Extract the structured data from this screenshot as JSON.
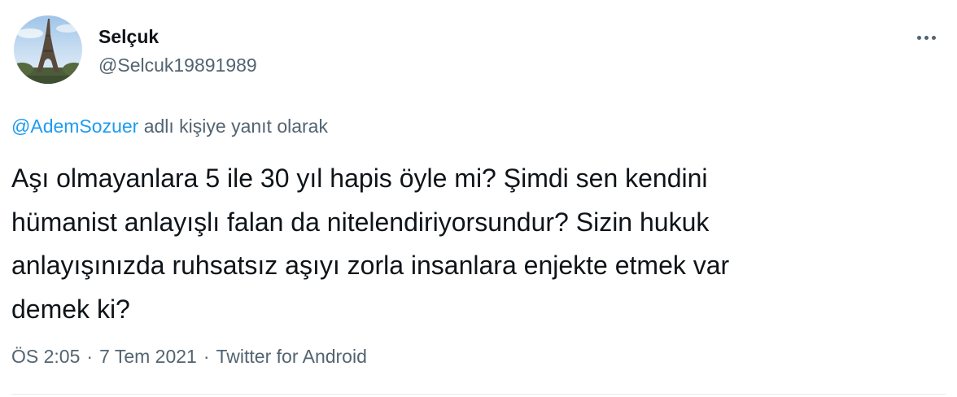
{
  "tweet": {
    "author": {
      "display_name": "Selçuk",
      "handle": "@Selcuk19891989",
      "avatar": "eiffel-tower-photo"
    },
    "more_icon": "more-horizontal-icon",
    "reply_to": {
      "mention": "@AdemSozuer",
      "suffix": " adlı kişiye yanıt olarak"
    },
    "text": "Aşı olmayanlara 5 ile 30 yıl hapis öyle mi? Şimdi sen kendini\nhümanist anlayışlı falan da nitelendiriyorsundur? Sizin hukuk\nanlayışınızda ruhsatsız aşıyı zorla insanlara enjekte etmek var\ndemek ki?",
    "meta": {
      "time": "ÖS 2:05",
      "date": "7 Tem 2021",
      "source": "Twitter for Android",
      "separator": "·"
    }
  },
  "colors": {
    "text_primary": "#0f1419",
    "text_secondary": "#536471",
    "link": "#1d9bf0",
    "divider": "#e6ecf0"
  }
}
